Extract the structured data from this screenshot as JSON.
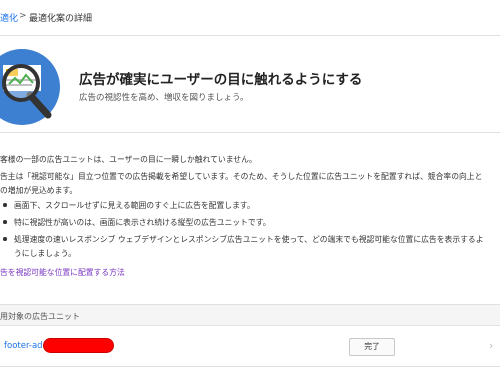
{
  "breadcrumb": {
    "parent": "適化",
    "separator": ">",
    "current": "最適化案の詳細"
  },
  "hero": {
    "icon": "magnifier-ad-icon",
    "title": "広告が確実にユーザーの目に触れるようにする",
    "subtitle": "広告の視認性を高め、増収を図りましょう。"
  },
  "body": {
    "intro": "客様の一部の広告ユニットは、ユーザーの目に一瞬しか触れていません。",
    "para_line1": "告主は「視認可能な」目立つ位置での広告掲載を希望しています。そのため、そうした位置に広告ユニットを配置すれば、競合率の向上と",
    "para_line2": "の増加が見込めます。",
    "bullets": [
      "画面下、スクロールせずに見える範囲のすぐ上に広告を配置します。",
      "特に視認性が高いのは、画面に表示され続ける縦型の広告ユニットです。",
      "処理速度の速いレスポンシブ ウェブデザインとレスポンシブ広告ユニットを使って、どの端末でも視認可能な位置に広告を表示するよ"
    ],
    "bullet3_cont": "うにしましょう。",
    "link": "告を視認可能な位置に配置する方法"
  },
  "section": {
    "title": "用対象の広告ユニット"
  },
  "rows": [
    {
      "name": "footer-ad",
      "redacted": true,
      "button": "完了",
      "chevron": "›"
    }
  ],
  "colors": {
    "link_blue": "#1a73e8",
    "link_purple": "#7a35c2",
    "redact_red": "#ff0000",
    "icon_blue": "#4a8fd8"
  }
}
